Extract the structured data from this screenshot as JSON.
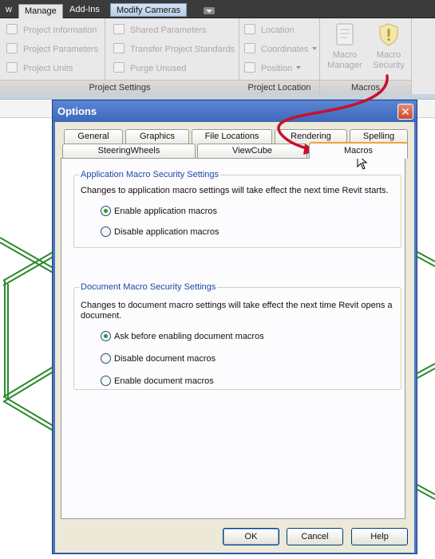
{
  "ribbon_tabs": [
    "w",
    "Manage",
    "Add-Ins",
    "Modify Cameras"
  ],
  "ribbon_active_tab": "Manage",
  "panels": {
    "project_settings": {
      "title": "Project Settings",
      "items": [
        "Project Information",
        "Project Parameters",
        "Project Units"
      ]
    },
    "shared": {
      "items": [
        "Shared Parameters",
        "Transfer Project Standards",
        "Purge Unused"
      ]
    },
    "project_location": {
      "title": "Project Location",
      "items": [
        "Location",
        "Coordinates",
        "Position"
      ]
    },
    "macros": {
      "title": "Macros",
      "manager_line1": "Macro",
      "manager_line2": "Manager",
      "security_line1": "Macro",
      "security_line2": "Security"
    }
  },
  "dialog": {
    "title": "Options",
    "tabs_back": [
      "General",
      "Graphics",
      "File Locations",
      "Rendering",
      "Spelling"
    ],
    "tabs_front": [
      "SteeringWheels",
      "ViewCube",
      "Macros"
    ],
    "selected_tab": "Macros",
    "app_group": {
      "legend": "Application Macro Security Settings",
      "description": "Changes to application macro settings will take effect the next time Revit starts.",
      "options": [
        "Enable application macros",
        "Disable application macros"
      ],
      "selected": 0
    },
    "doc_group": {
      "legend": "Document Macro Security Settings",
      "description": "Changes to document macro settings will take effect the next time Revit opens a document.",
      "options": [
        "Ask before enabling document macros",
        "Disable document macros",
        "Enable document macros"
      ],
      "selected": 0
    },
    "buttons": {
      "ok": "OK",
      "cancel": "Cancel",
      "help": "Help"
    }
  },
  "colors": {
    "accent_red_arrow": "#c8102e",
    "wireframe_green": "#2a8a2a",
    "titlebar_blue": "#4a74c4",
    "group_legend_blue": "#1f47a8"
  }
}
